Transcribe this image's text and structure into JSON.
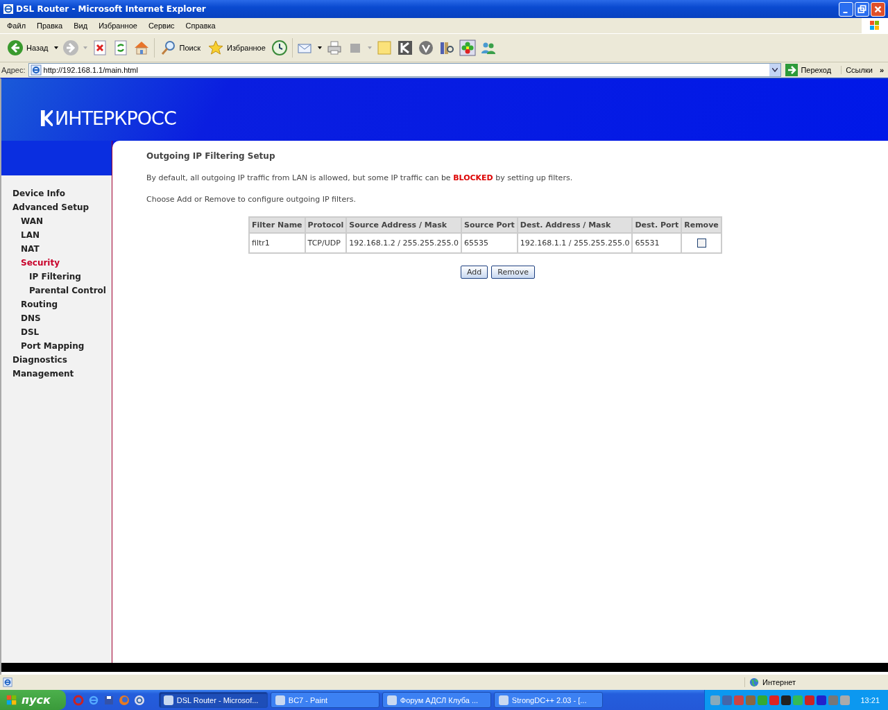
{
  "window": {
    "title": "DSL Router - Microsoft Internet Explorer"
  },
  "menu": [
    "Файл",
    "Правка",
    "Вид",
    "Избранное",
    "Сервис",
    "Справка"
  ],
  "toolbar": {
    "back_label": "Назад",
    "search_label": "Поиск",
    "favorites_label": "Избранное"
  },
  "address_bar": {
    "label": "Адрес:",
    "value": "http://192.168.1.1/main.html",
    "go_label": "Переход",
    "links_label": "Ссылки",
    "more": "»"
  },
  "page": {
    "logo": "ИНТЕРКРОСС",
    "sidebar": {
      "items": [
        {
          "label": "Device Info",
          "selected": false
        },
        {
          "label": "Advanced Setup",
          "selected": false,
          "children": [
            {
              "label": "WAN",
              "selected": false
            },
            {
              "label": "LAN",
              "selected": false
            },
            {
              "label": "NAT",
              "selected": false
            },
            {
              "label": "Security",
              "selected": true,
              "children": [
                {
                  "label": "IP Filtering",
                  "selected": false
                },
                {
                  "label": "Parental Control",
                  "selected": false
                }
              ]
            },
            {
              "label": "Routing",
              "selected": false
            },
            {
              "label": "DNS",
              "selected": false
            },
            {
              "label": "DSL",
              "selected": false
            },
            {
              "label": "Port Mapping",
              "selected": false
            }
          ]
        },
        {
          "label": "Diagnostics",
          "selected": false
        },
        {
          "label": "Management",
          "selected": false
        }
      ]
    },
    "title": "Outgoing IP Filtering Setup",
    "paragraphs": [
      "By default, all outgoing IP traffic from LAN is allowed, but some IP traffic can be **BLOCKED** by setting up filters.",
      "Choose Add or Remove to configure outgoing IP filters."
    ],
    "table": {
      "columns": [
        "Filter Name",
        "Protocol",
        "Source Address / Mask",
        "Source Port",
        "Dest. Address / Mask",
        "Dest. Port",
        "Remove"
      ],
      "rows": [
        {
          "cells": [
            "filtr1",
            "TCP/UDP",
            "192.168.1.2 / 255.255.255.0",
            "65535",
            "192.168.1.1 / 255.255.255.0",
            "65531"
          ],
          "remove_checked": false
        }
      ]
    },
    "buttons": [
      "Add",
      "Remove"
    ]
  },
  "status_bar": {
    "zone": "Интернет"
  },
  "taskbar": {
    "start": "пуск",
    "tasks": [
      {
        "label": "DSL Router - Microsof...",
        "selected": true
      },
      {
        "label": "BC7 - Paint",
        "selected": false
      },
      {
        "label": "Форум АДСЛ Клуба ...",
        "selected": false
      },
      {
        "label": "StrongDC++ 2.03 - [...",
        "selected": false
      }
    ],
    "clock": "13:21"
  }
}
